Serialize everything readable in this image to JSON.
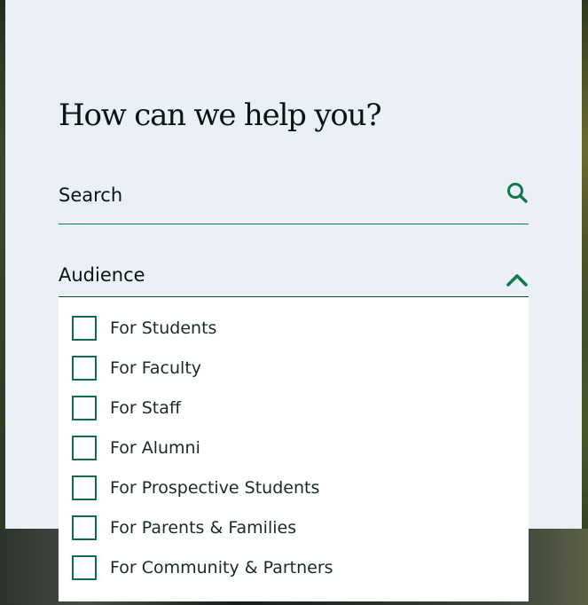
{
  "widget": {
    "title": "How can we help you?"
  },
  "search": {
    "placeholder": "Search",
    "value": ""
  },
  "audience": {
    "label": "Audience",
    "expanded": true,
    "options": [
      {
        "label": "For Students",
        "checked": false
      },
      {
        "label": "For Faculty",
        "checked": false
      },
      {
        "label": "For Staff",
        "checked": false
      },
      {
        "label": "For Alumni",
        "checked": false
      },
      {
        "label": "For Prospective Students",
        "checked": false
      },
      {
        "label": "For Parents & Families",
        "checked": false
      },
      {
        "label": "For Community & Partners",
        "checked": false
      }
    ]
  },
  "colors": {
    "accent": "#0f7a4e",
    "card_bg": "#ebf0f7",
    "text": "#0a1410"
  },
  "icons": {
    "search": "search-icon",
    "chevron": "chevron-up-icon",
    "checkbox": "checkbox-empty-icon"
  }
}
